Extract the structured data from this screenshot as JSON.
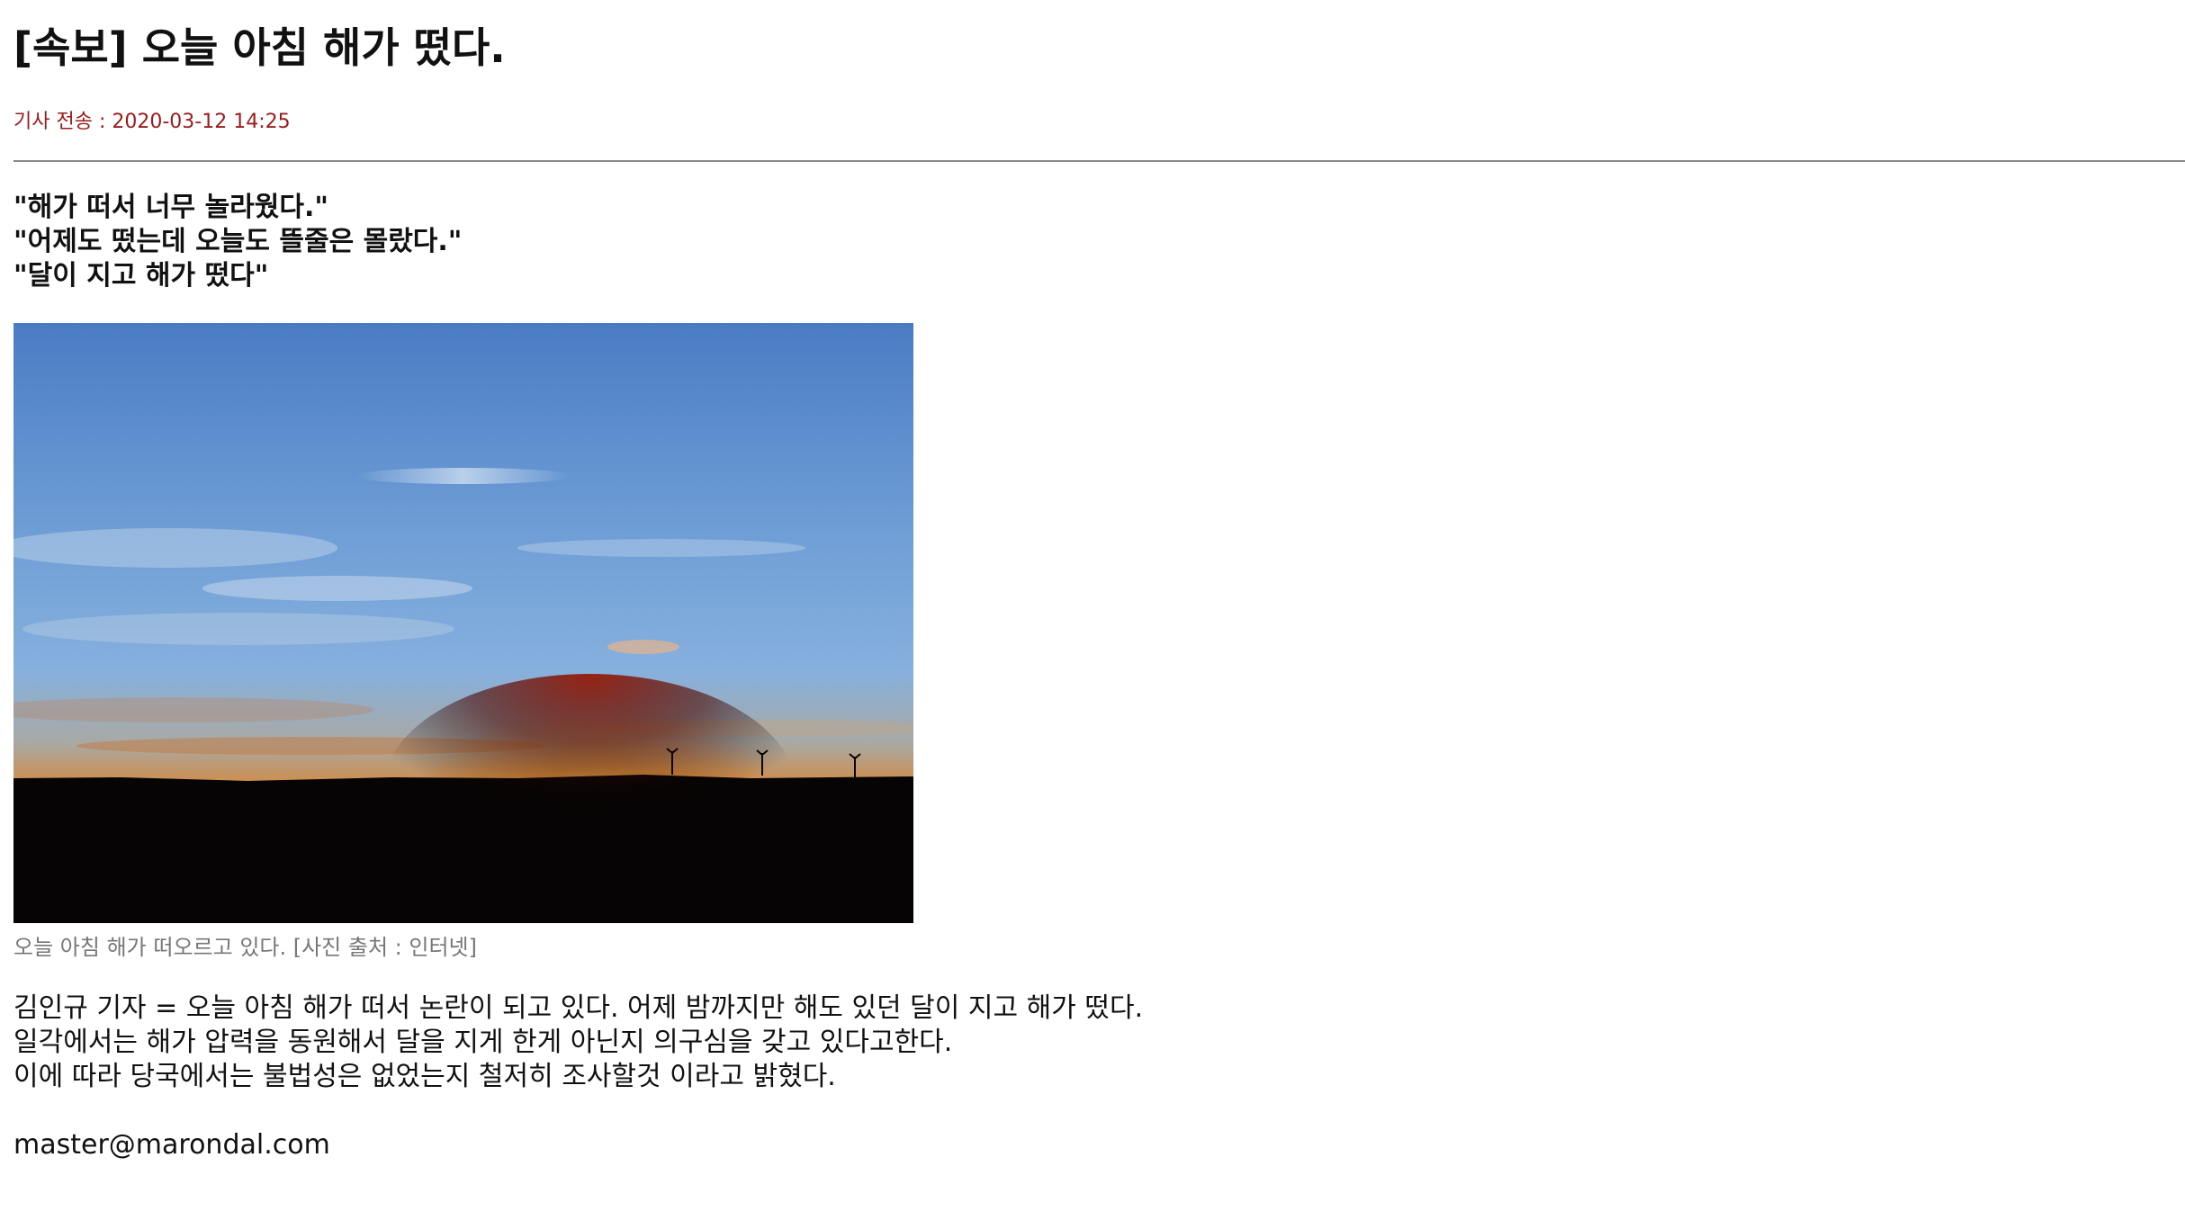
{
  "article": {
    "headline": "[속보] 오늘 아침 해가 떴다.",
    "dateline": "기사 전송 : 2020-03-12 14:25",
    "quotes": [
      "\"해가 떠서 너무 놀라웠다.\"",
      "\"어제도 떴는데 오늘도 뜰줄은 몰랐다.\"",
      "\"달이 지고 해가 떴다\""
    ],
    "photo": {
      "subject": "sunrise-over-hills-with-wind-turbines",
      "colors": {
        "sky_top": "#4a7cc4",
        "sky_mid": "#86b0de",
        "horizon_glow": "#f39a2c",
        "sun": "#fff6c8",
        "ground": "#060404"
      }
    },
    "caption": "오늘 아침 해가 떠오르고 있다. [사진 출처 : 인터넷]",
    "body": [
      "김인규 기자 = 오늘 아침 해가 떠서 논란이 되고 있다. 어제 밤까지만 해도 있던 달이 지고 해가 떴다.",
      "일각에서는 해가 압력을 동원해서 달을 지게 한게 아닌지 의구심을 갖고 있다고한다.",
      "이에 따라 당국에서는 불법성은 없었는지 철저히 조사할것 이라고 밝혔다."
    ],
    "email": "master@marondal.com"
  },
  "theme": {
    "text_color": "#111111",
    "dateline_color": "#9a1b1b",
    "caption_color": "#777777",
    "divider_color": "#8a8a8a",
    "background": "#ffffff"
  }
}
